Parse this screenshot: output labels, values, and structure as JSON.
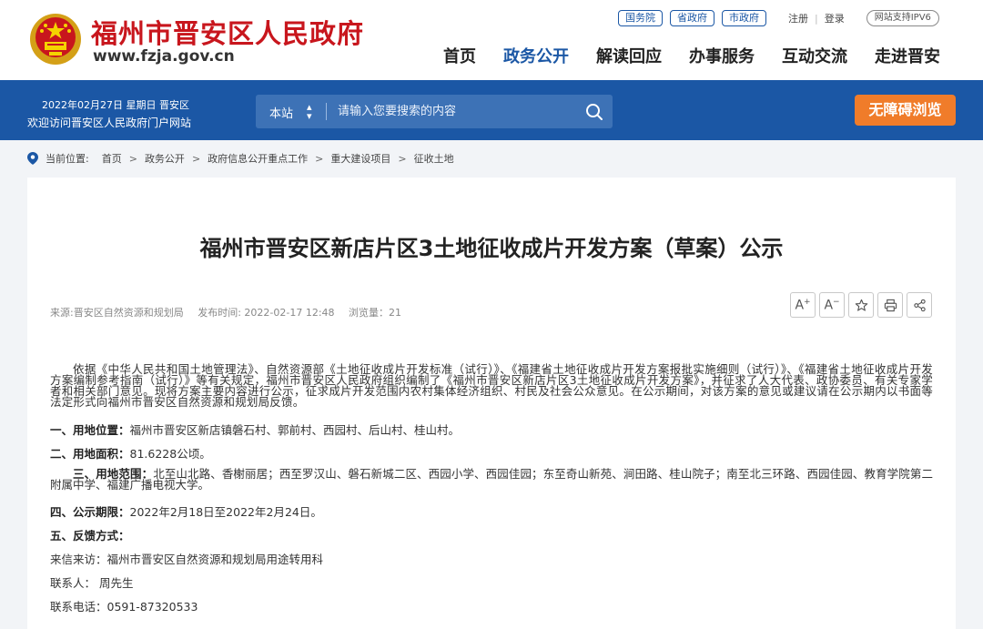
{
  "header": {
    "site_name": "福州市晋安区人民政府",
    "domain": "www.fzja.gov.cn",
    "top_links": [
      "国务院",
      "省政府",
      "市政府"
    ],
    "register": "注册",
    "login": "登录",
    "ipv6": "网站支持IPV6",
    "nav": [
      "首页",
      "政务公开",
      "解读回应",
      "办事服务",
      "互动交流",
      "走进晋安"
    ],
    "active_nav": "政务公开"
  },
  "band": {
    "date": "2022年02月27日 星期日 晋安区",
    "welcome": "欢迎访问晋安区人民政府门户网站",
    "search_scope": "本站",
    "search_placeholder": "请输入您要搜索的内容",
    "accessibility": "无障碍浏览"
  },
  "breadcrumb": {
    "label": "当前位置:",
    "items": [
      "首页",
      "政务公开",
      "政府信息公开重点工作",
      "重大建设项目",
      "征收土地"
    ]
  },
  "article": {
    "title": "福州市晋安区新店片区3土地征收成片开发方案（草案）公示",
    "source": "来源:晋安区自然资源和规划局",
    "published": "发布时间: 2022-02-17 12:48",
    "views": "浏览量：21",
    "intro": "依据《中华人民共和国土地管理法》、自然资源部《土地征收成片开发标准（试行）》、《福建省土地征收成片开发方案报批实施细则（试行）》、《福建省土地征收成片开发方案编制参考指南（试行）》等有关规定，福州市晋安区人民政府组织编制了《福州市晋安区新店片区3土地征收成片开发方案》，并征求了人大代表、政协委员、有关专家学者和相关部门意见。现将方案主要内容进行公示，征求成片开发范围内农村集体经济组织、村民及社会公众意见。在公示期间，对该方案的意见或建议请在公示期内以书面等法定形式向福州市晋安区自然资源和规划局反馈。",
    "items": [
      {
        "label": "一、用地位置：",
        "text": "福州市晋安区新店镇磐石村、郭前村、西园村、后山村、桂山村。"
      },
      {
        "label": "二、用地面积：",
        "text": "81.6228公顷。"
      },
      {
        "label": "三、用地范围：",
        "text": "北至山北路、香榭丽居；西至罗汉山、磐石新城二区、西园小学、西园佳园；东至奇山新苑、涧田路、桂山院子；南至北三环路、西园佳园、教育学院第二附属中学、福建广播电视大学。"
      },
      {
        "label": "四、公示期限：",
        "text": "2022年2月18日至2022年2月24日。"
      },
      {
        "label": "五、反馈方式：",
        "text": ""
      }
    ],
    "contact_address": "来信来访：福州市晋安区自然资源和规划局用途转用科",
    "contact_person": "联系人：  周先生",
    "contact_phone": "联系电话：0591-87320533"
  },
  "colors": {
    "brand_blue": "#1b57a5",
    "brand_red": "#c8161d",
    "accent_orange": "#f07c2a"
  },
  "icons": [
    "national-emblem-icon",
    "search-icon",
    "location-pin-icon",
    "font-increase-icon",
    "font-decrease-icon",
    "star-icon",
    "print-icon",
    "share-icon"
  ]
}
